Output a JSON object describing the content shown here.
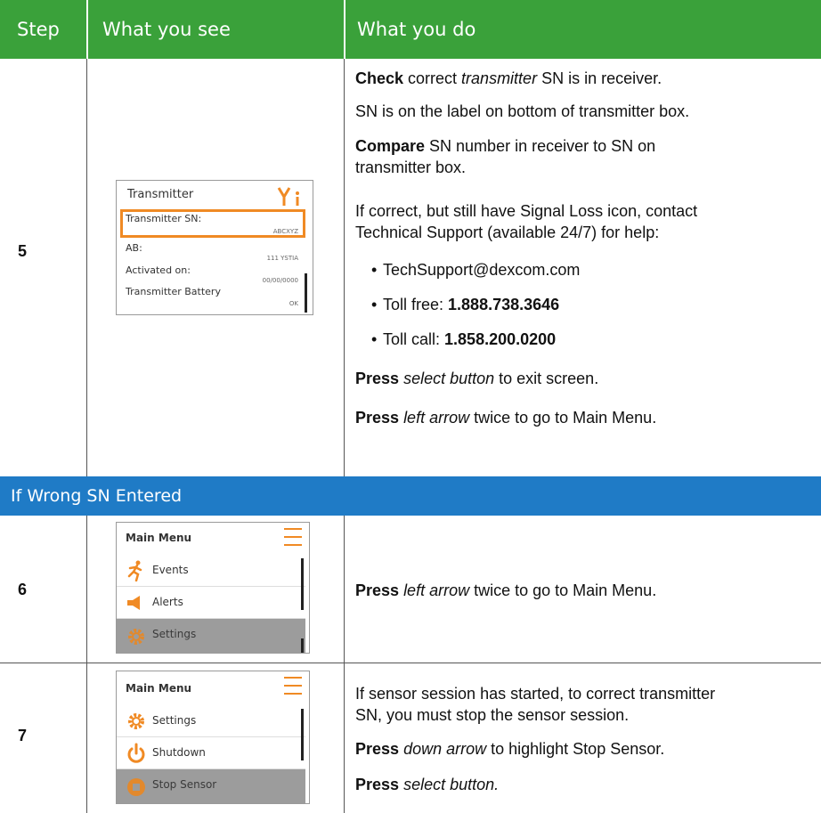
{
  "header": {
    "col_step": "Step",
    "col_see": "What you see",
    "col_do": "What you do"
  },
  "section_banner": "If Wrong SN Entered",
  "rows": [
    {
      "step": "5",
      "screen": {
        "title": "Transmitter",
        "icon": "signal-loss-info-icon",
        "items": [
          {
            "label": "Transmitter SN:",
            "value": "ABCXYZ"
          },
          {
            "label": "AB:",
            "value": "111 YSTIA"
          },
          {
            "label": "Activated on:",
            "value": "00/00/0000"
          },
          {
            "label": "Transmitter Battery",
            "value": "OK"
          }
        ]
      },
      "instructions": {
        "l1_b": "Check",
        "l1_t1": " correct ",
        "l1_i": "transmitter",
        "l1_t2": " SN is in receiver.",
        "l2": "SN is on the label on bottom of transmitter box.",
        "l3_b": "Compare",
        "l3_t": " SN number in receiver to SN on",
        "l3_t2": "transmitter box.",
        "l4": "If correct, but still have Signal Loss icon, contact",
        "l4b": "Technical Support (available 24/7) for help:",
        "bullet1": "TechSupport@dexcom.com",
        "bullet2_t": "Toll free: ",
        "bullet2_b": "1.888.738.3646",
        "bullet3_t": "Toll call: ",
        "bullet3_b": "1.858.200.0200",
        "l5_b": "Press",
        "l5_i": "select button",
        "l5_t": " to exit screen.",
        "l6_b": "Press",
        "l6_i": "left arrow",
        "l6_t": " twice to go to Main Menu."
      }
    },
    {
      "step": "6",
      "screen": {
        "title": "Main Menu",
        "items": [
          {
            "label": "Events",
            "icon": "running-person-icon"
          },
          {
            "label": "Alerts",
            "icon": "speaker-icon"
          },
          {
            "label": "Settings",
            "icon": "gear-icon",
            "selected": true
          }
        ]
      },
      "instructions": {
        "l1_b": "Press",
        "l1_i": "left arrow",
        "l1_t": " twice to go to Main Menu."
      }
    },
    {
      "step": "7",
      "screen": {
        "title": "Main Menu",
        "items": [
          {
            "label": "Settings",
            "icon": "gear-icon"
          },
          {
            "label": "Shutdown",
            "icon": "power-icon"
          },
          {
            "label": "Stop Sensor",
            "icon": "stop-sensor-icon",
            "selected": true
          }
        ]
      },
      "instructions": {
        "l1": "If sensor session has started, to correct transmitter",
        "l1b": "SN, you must stop the sensor session.",
        "l2_b": "Press",
        "l2_i": "down arrow",
        "l2_t": " to highlight Stop Sensor.",
        "l3_b": "Press",
        "l3_i": "select button."
      }
    }
  ],
  "colors": {
    "header_green": "#3aa13a",
    "section_blue": "#1f7bc6",
    "accent_orange": "#f08a24"
  }
}
